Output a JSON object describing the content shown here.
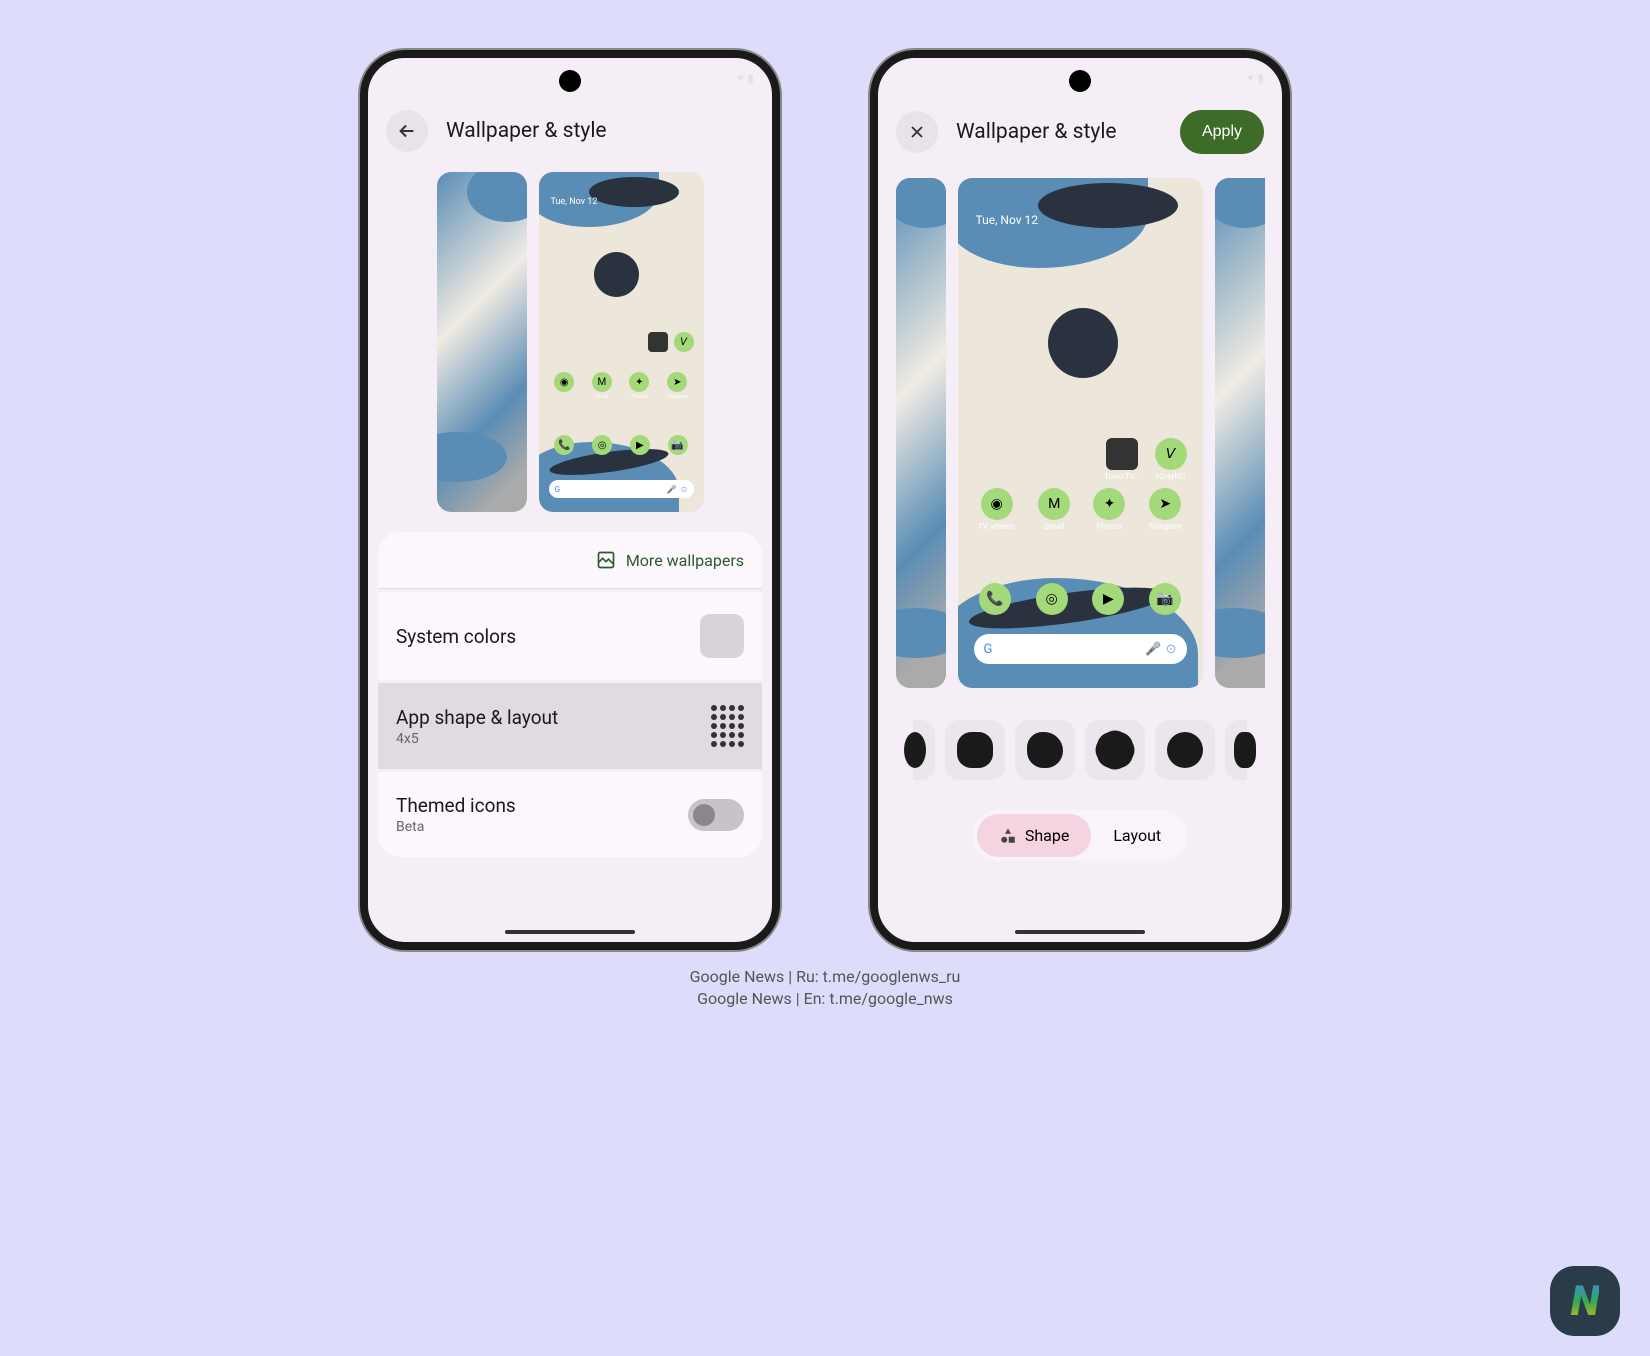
{
  "phone1": {
    "header": {
      "title": "Wallpaper & style"
    },
    "preview": {
      "date": "Tue, Nov 12"
    },
    "more_wallpapers": "More wallpapers",
    "options": {
      "system_colors": "System colors",
      "app_shape": {
        "title": "App shape & layout",
        "sub": "4x5"
      },
      "themed_icons": {
        "title": "Themed icons",
        "sub": "Beta"
      }
    },
    "apps": {
      "photos": "Photos",
      "gmail": "Gmail",
      "telegram": "Telegram"
    }
  },
  "phone2": {
    "header": {
      "title": "Wallpaper & style",
      "apply": "Apply"
    },
    "preview": {
      "date": "Tue, Nov 12"
    },
    "apps": {
      "tuvio": "Tuvio TV...",
      "v2ray": "v2rayNG",
      "tvwheels": "TV wheels",
      "gmail": "Gmail",
      "photos": "Photos",
      "telegram": "Telegram"
    },
    "tabs": {
      "shape": "Shape",
      "layout": "Layout"
    }
  },
  "search_glyph": "G",
  "footer": {
    "line1": "Google News | Ru: t.me/googlenws_ru",
    "line2": "Google News | En: t.me/google_nws"
  },
  "watermark": "N",
  "shapes": [
    "squircle",
    "circle",
    "flower",
    "circle"
  ],
  "colors": {
    "accent_green": "#a4d97a",
    "apply_green": "#3d6b28",
    "tab_pink": "#f4d4e0"
  }
}
